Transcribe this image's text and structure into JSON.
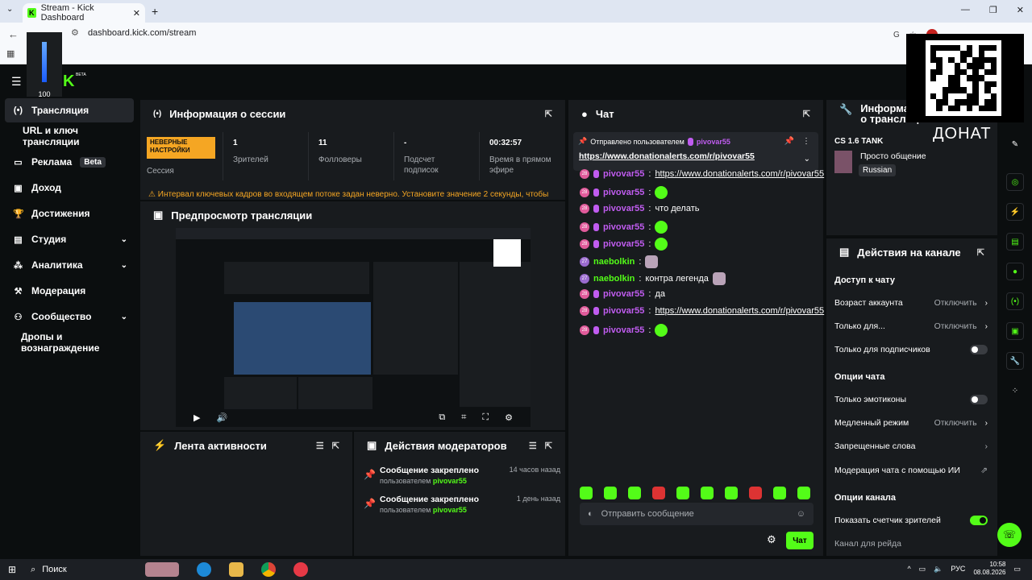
{
  "browser": {
    "tab_title": "Stream - Kick Dashboard",
    "url": "dashboard.kick.com/stream",
    "search_engine_label": "Google"
  },
  "app": {
    "logo_text": "K",
    "beta_tag": "BETA",
    "volume_level": "100"
  },
  "sidebar": {
    "items": [
      {
        "label": "Трансляция",
        "icon": "broadcast-icon",
        "active": true
      },
      {
        "label": "URL и ключ трансляции",
        "icon": "",
        "sub": true
      },
      {
        "label": "Реклама",
        "icon": "ads-icon",
        "badge": "Beta"
      },
      {
        "label": "Доход",
        "icon": "revenue-icon"
      },
      {
        "label": "Достижения",
        "icon": "trophy-icon"
      },
      {
        "label": "Студия",
        "icon": "studio-icon",
        "expandable": true
      },
      {
        "label": "Аналитика",
        "icon": "analytics-icon",
        "expandable": true
      },
      {
        "label": "Модерация",
        "icon": "moderation-icon"
      },
      {
        "label": "Сообщество",
        "icon": "community-icon",
        "expandable": true
      },
      {
        "label": "Дропы и вознаграждение",
        "icon": "",
        "sub": true
      }
    ]
  },
  "session": {
    "title": "Информация о сессии",
    "badge": "НЕВЕРНЫЕ НАСТРОЙКИ",
    "stats": [
      {
        "value": "",
        "label": "Сессия"
      },
      {
        "value": "1",
        "label": "Зрителей"
      },
      {
        "value": "11",
        "label": "Фолловеры"
      },
      {
        "value": "-",
        "label": "Подсчет подписок"
      },
      {
        "value": "00:32:57",
        "label": "Время в прямом эфире"
      }
    ],
    "warning": "Интервал ключевых кадров во входящем потоке задан неверно. Установите значение 2 секунды, чтобы"
  },
  "preview": {
    "title": "Предпросмотр трансляции"
  },
  "activity": {
    "title": "Лента активности"
  },
  "modactions": {
    "title": "Действия модераторов",
    "items": [
      {
        "title": "Сообщение закреплено",
        "by": "пользователем",
        "user": "pivovar55",
        "time": "14 часов назад"
      },
      {
        "title": "Сообщение закреплено",
        "by": "пользователем",
        "user": "pivovar55",
        "time": "1 день назад"
      }
    ]
  },
  "chat": {
    "title": "Чат",
    "pinned_label": "Отправлено пользователем",
    "pinned_user": "pivovar55",
    "pinned_link": "https://www.donationalerts.com/r/pivovar55",
    "messages": [
      {
        "badge": "28",
        "user": "pivovar55",
        "text": "https://www.donationalerts.com/r/pivovar55",
        "link": true
      },
      {
        "badge": "28",
        "user": "pivovar55",
        "text": "",
        "emote": true
      },
      {
        "badge": "28",
        "user": "pivovar55",
        "text": "что делать"
      },
      {
        "badge": "28",
        "user": "pivovar55",
        "text": "",
        "emote": true
      },
      {
        "badge": "28",
        "user": "pivovar55",
        "text": "",
        "emote": true
      },
      {
        "badge": "27",
        "user": "naebolkin",
        "text": "",
        "emote": true,
        "green": true
      },
      {
        "badge": "27",
        "user": "naebolkin",
        "text": "контра легенда",
        "emote": true,
        "green": true
      },
      {
        "badge": "28",
        "user": "pivovar55",
        "text": "да"
      },
      {
        "badge": "28",
        "user": "pivovar55",
        "text": "https://www.donationalerts.com/r/pivovar55",
        "link": true
      },
      {
        "badge": "28",
        "user": "pivovar55",
        "text": "",
        "emote": true
      }
    ],
    "placeholder": "Отправить сообщение",
    "send_label": "Чат"
  },
  "streaminfo": {
    "title": "Информация о трансляции",
    "game": "CS 1.6 TANK",
    "category": "Просто общение",
    "language": "Russian"
  },
  "channel": {
    "title": "Действия на канале",
    "chat_access_title": "Доступ к чату",
    "account_age_label": "Возраст аккаунта",
    "account_age_value": "Отключить",
    "only_for_label": "Только для...",
    "only_for_value": "Отключить",
    "subs_only_label": "Только для подписчиков",
    "chat_options_title": "Опции чата",
    "emotes_only_label": "Только эмотиконы",
    "slow_mode_label": "Медленный режим",
    "slow_mode_value": "Отключить",
    "banned_words_label": "Запрещенные слова",
    "ai_mod_label": "Модерация чата с помощью ИИ",
    "channel_options_title": "Опции канала",
    "show_viewers_label": "Показать счетчик зрителей",
    "raid_channel_label": "Канал для рейда"
  },
  "overlay": {
    "donate_text": "ДОНАТ"
  },
  "taskbar": {
    "search_label": "Поиск",
    "lang": "РУС",
    "time": "10:58",
    "date": "08.08.2026"
  },
  "colors": {
    "accent": "#53fc18",
    "warning": "#f5a623",
    "username": "#c05cf0",
    "panel": "#181b1e",
    "background": "#0b0e0f"
  }
}
